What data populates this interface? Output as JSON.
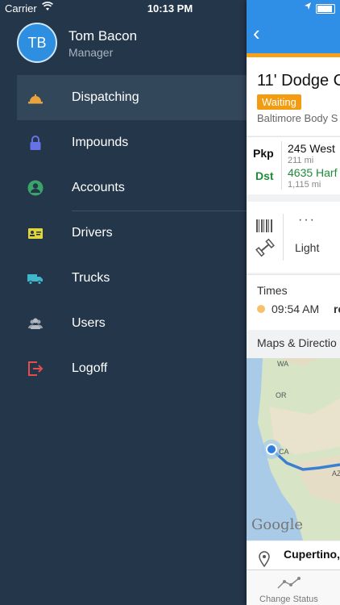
{
  "status": {
    "carrier": "Carrier",
    "time": "10:13 PM"
  },
  "user": {
    "initials": "TB",
    "name": "Tom Bacon",
    "role": "Manager"
  },
  "menu": [
    {
      "label": "Dispatching",
      "icon": "bell-icon",
      "color": "#e8a33c"
    },
    {
      "label": "Impounds",
      "icon": "lock-icon",
      "color": "#6673e6"
    },
    {
      "label": "Accounts",
      "icon": "person-icon",
      "color": "#3aa56a"
    },
    {
      "label": "Drivers",
      "icon": "id-card-icon",
      "color": "#e2d536"
    },
    {
      "label": "Trucks",
      "icon": "truck-icon",
      "color": "#3fb6c9"
    },
    {
      "label": "Users",
      "icon": "users-icon",
      "color": "#9aa3ad"
    },
    {
      "label": "Logoff",
      "icon": "logoff-icon",
      "color": "#e74c4c"
    }
  ],
  "detail": {
    "title": "11' Dodge C",
    "status": "Waiting",
    "company": "Baltimore Body S",
    "pickup_label": "Pkp",
    "dest_label": "Dst",
    "pickup_address": "245 West",
    "pickup_distance": "211 mi",
    "dest_address": "4635 Harf",
    "dest_distance": "1,115 mi",
    "more": "···",
    "weight_class": "Light",
    "times_heading": "Times",
    "time_value": "09:54 AM",
    "time_extra": "re",
    "maps_heading": "Maps & Directio",
    "map_labels": [
      "WA",
      "OR",
      "CA",
      "AZ"
    ],
    "map_brand": "Google",
    "location_name": "Cupertino,",
    "tab_label": "Change Status"
  }
}
